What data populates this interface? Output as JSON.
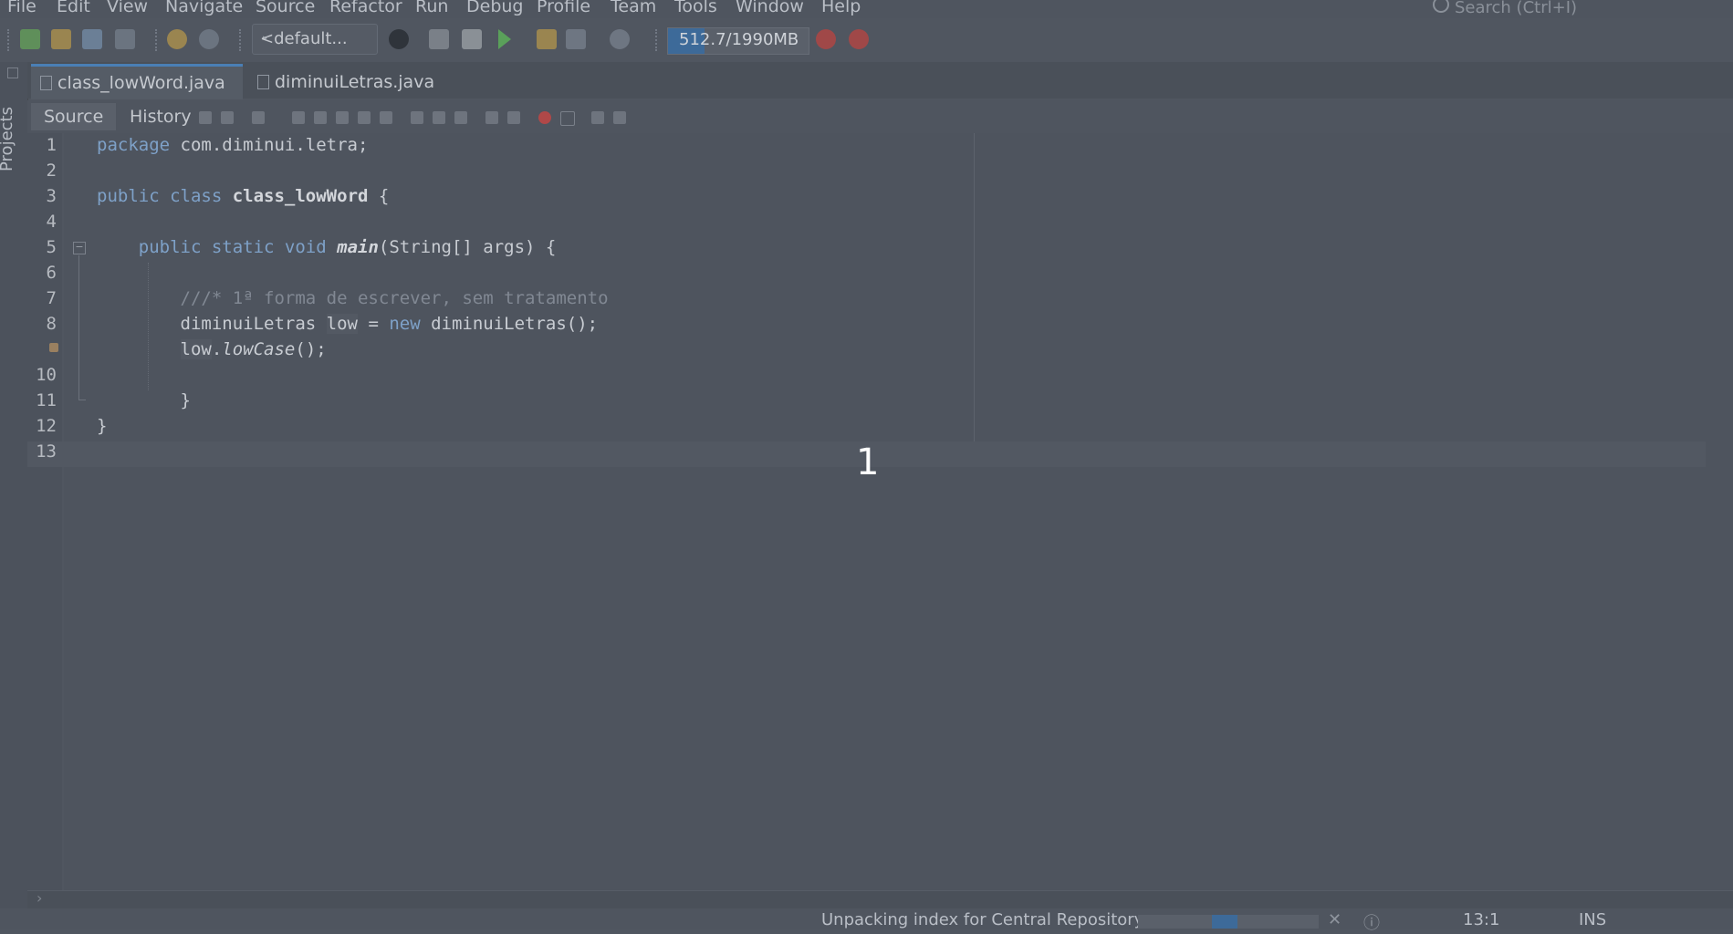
{
  "menu": [
    "File",
    "Edit",
    "View",
    "Navigate",
    "Source",
    "Refactor",
    "Run",
    "Debug",
    "Profile",
    "Team",
    "Tools",
    "Window",
    "Help"
  ],
  "search": {
    "placeholder": "Search (Ctrl+I)"
  },
  "toolbar": {
    "config_value": "<default...",
    "memory_text": "512.7/1990MB",
    "memory_fraction": 0.26
  },
  "side": {
    "projects_label": "Projects"
  },
  "tabs": [
    {
      "label": "class_lowWord.java",
      "active": true
    },
    {
      "label": "diminuiLetras.java",
      "active": false
    }
  ],
  "editor_tabs": {
    "source": "Source",
    "history": "History"
  },
  "code": {
    "line_numbers": [
      "1",
      "2",
      "3",
      "4",
      "5",
      "6",
      "7",
      "8",
      "",
      "10",
      "11",
      "12",
      "13"
    ],
    "lines": [
      "package com.diminui.letra;",
      "",
      "public class class_lowWord {",
      "",
      "    public static void main(String[] args) {",
      "",
      "        ///* 1ª forma de escrever, sem tratamento",
      "        diminuiLetras low = new diminuiLetras();",
      "        low.lowCase();",
      "",
      "        }",
      "}",
      ""
    ]
  },
  "overlay": {
    "number": "1"
  },
  "status": {
    "task": "Unpacking index for Central Repository",
    "progress_fraction": 0.55,
    "position": "13:1",
    "mode": "INS"
  }
}
